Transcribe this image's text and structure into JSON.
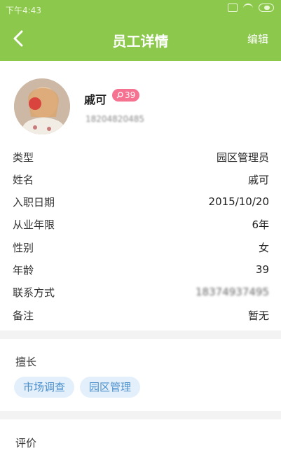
{
  "status_bar": {
    "time": "下午4:43"
  },
  "header": {
    "title": "员工详情",
    "edit_label": "编辑"
  },
  "profile": {
    "name": "戚可",
    "age_badge": "39",
    "phone_masked": "18204820485"
  },
  "details": [
    {
      "label": "类型",
      "value": "园区管理员"
    },
    {
      "label": "姓名",
      "value": "戚可"
    },
    {
      "label": "入职日期",
      "value": "2015/10/20"
    },
    {
      "label": "从业年限",
      "value": "6年"
    },
    {
      "label": "性别",
      "value": "女"
    },
    {
      "label": "年龄",
      "value": "39"
    },
    {
      "label": "联系方式",
      "value": "18374937495"
    },
    {
      "label": "备注",
      "value": "暂无"
    }
  ],
  "skills": {
    "title": "擅长",
    "tags": [
      "市场调查",
      "园区管理"
    ]
  },
  "reviews": {
    "title": "评价"
  },
  "colors": {
    "header": "#8cc84b",
    "badge": "#f57291",
    "tag_bg": "#e3effb",
    "tag_text": "#4a8fcc"
  }
}
